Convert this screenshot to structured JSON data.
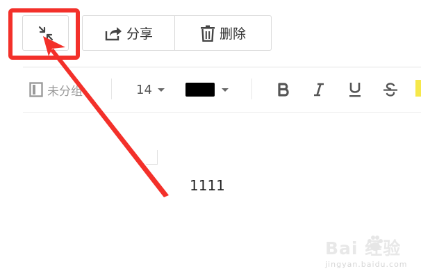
{
  "toolbar": {
    "collapse_icon": "collapse-arrows-icon",
    "share_label": "分享",
    "share_icon": "share-icon",
    "delete_label": "删除",
    "delete_icon": "trash-icon"
  },
  "format_bar": {
    "group_label": "未分组",
    "font_size": "14",
    "text_color": "#000000",
    "bold_icon": "bold-icon",
    "italic_icon": "italic-icon",
    "underline_icon": "underline-icon",
    "strikethrough_icon": "strikethrough-icon",
    "highlight_icon": "highlight-icon"
  },
  "document": {
    "body_text": "1111"
  },
  "annotation": {
    "color": "#f3302a"
  },
  "watermark": {
    "brand": "Bai  经验",
    "url": "jingyan.baidu.com"
  }
}
